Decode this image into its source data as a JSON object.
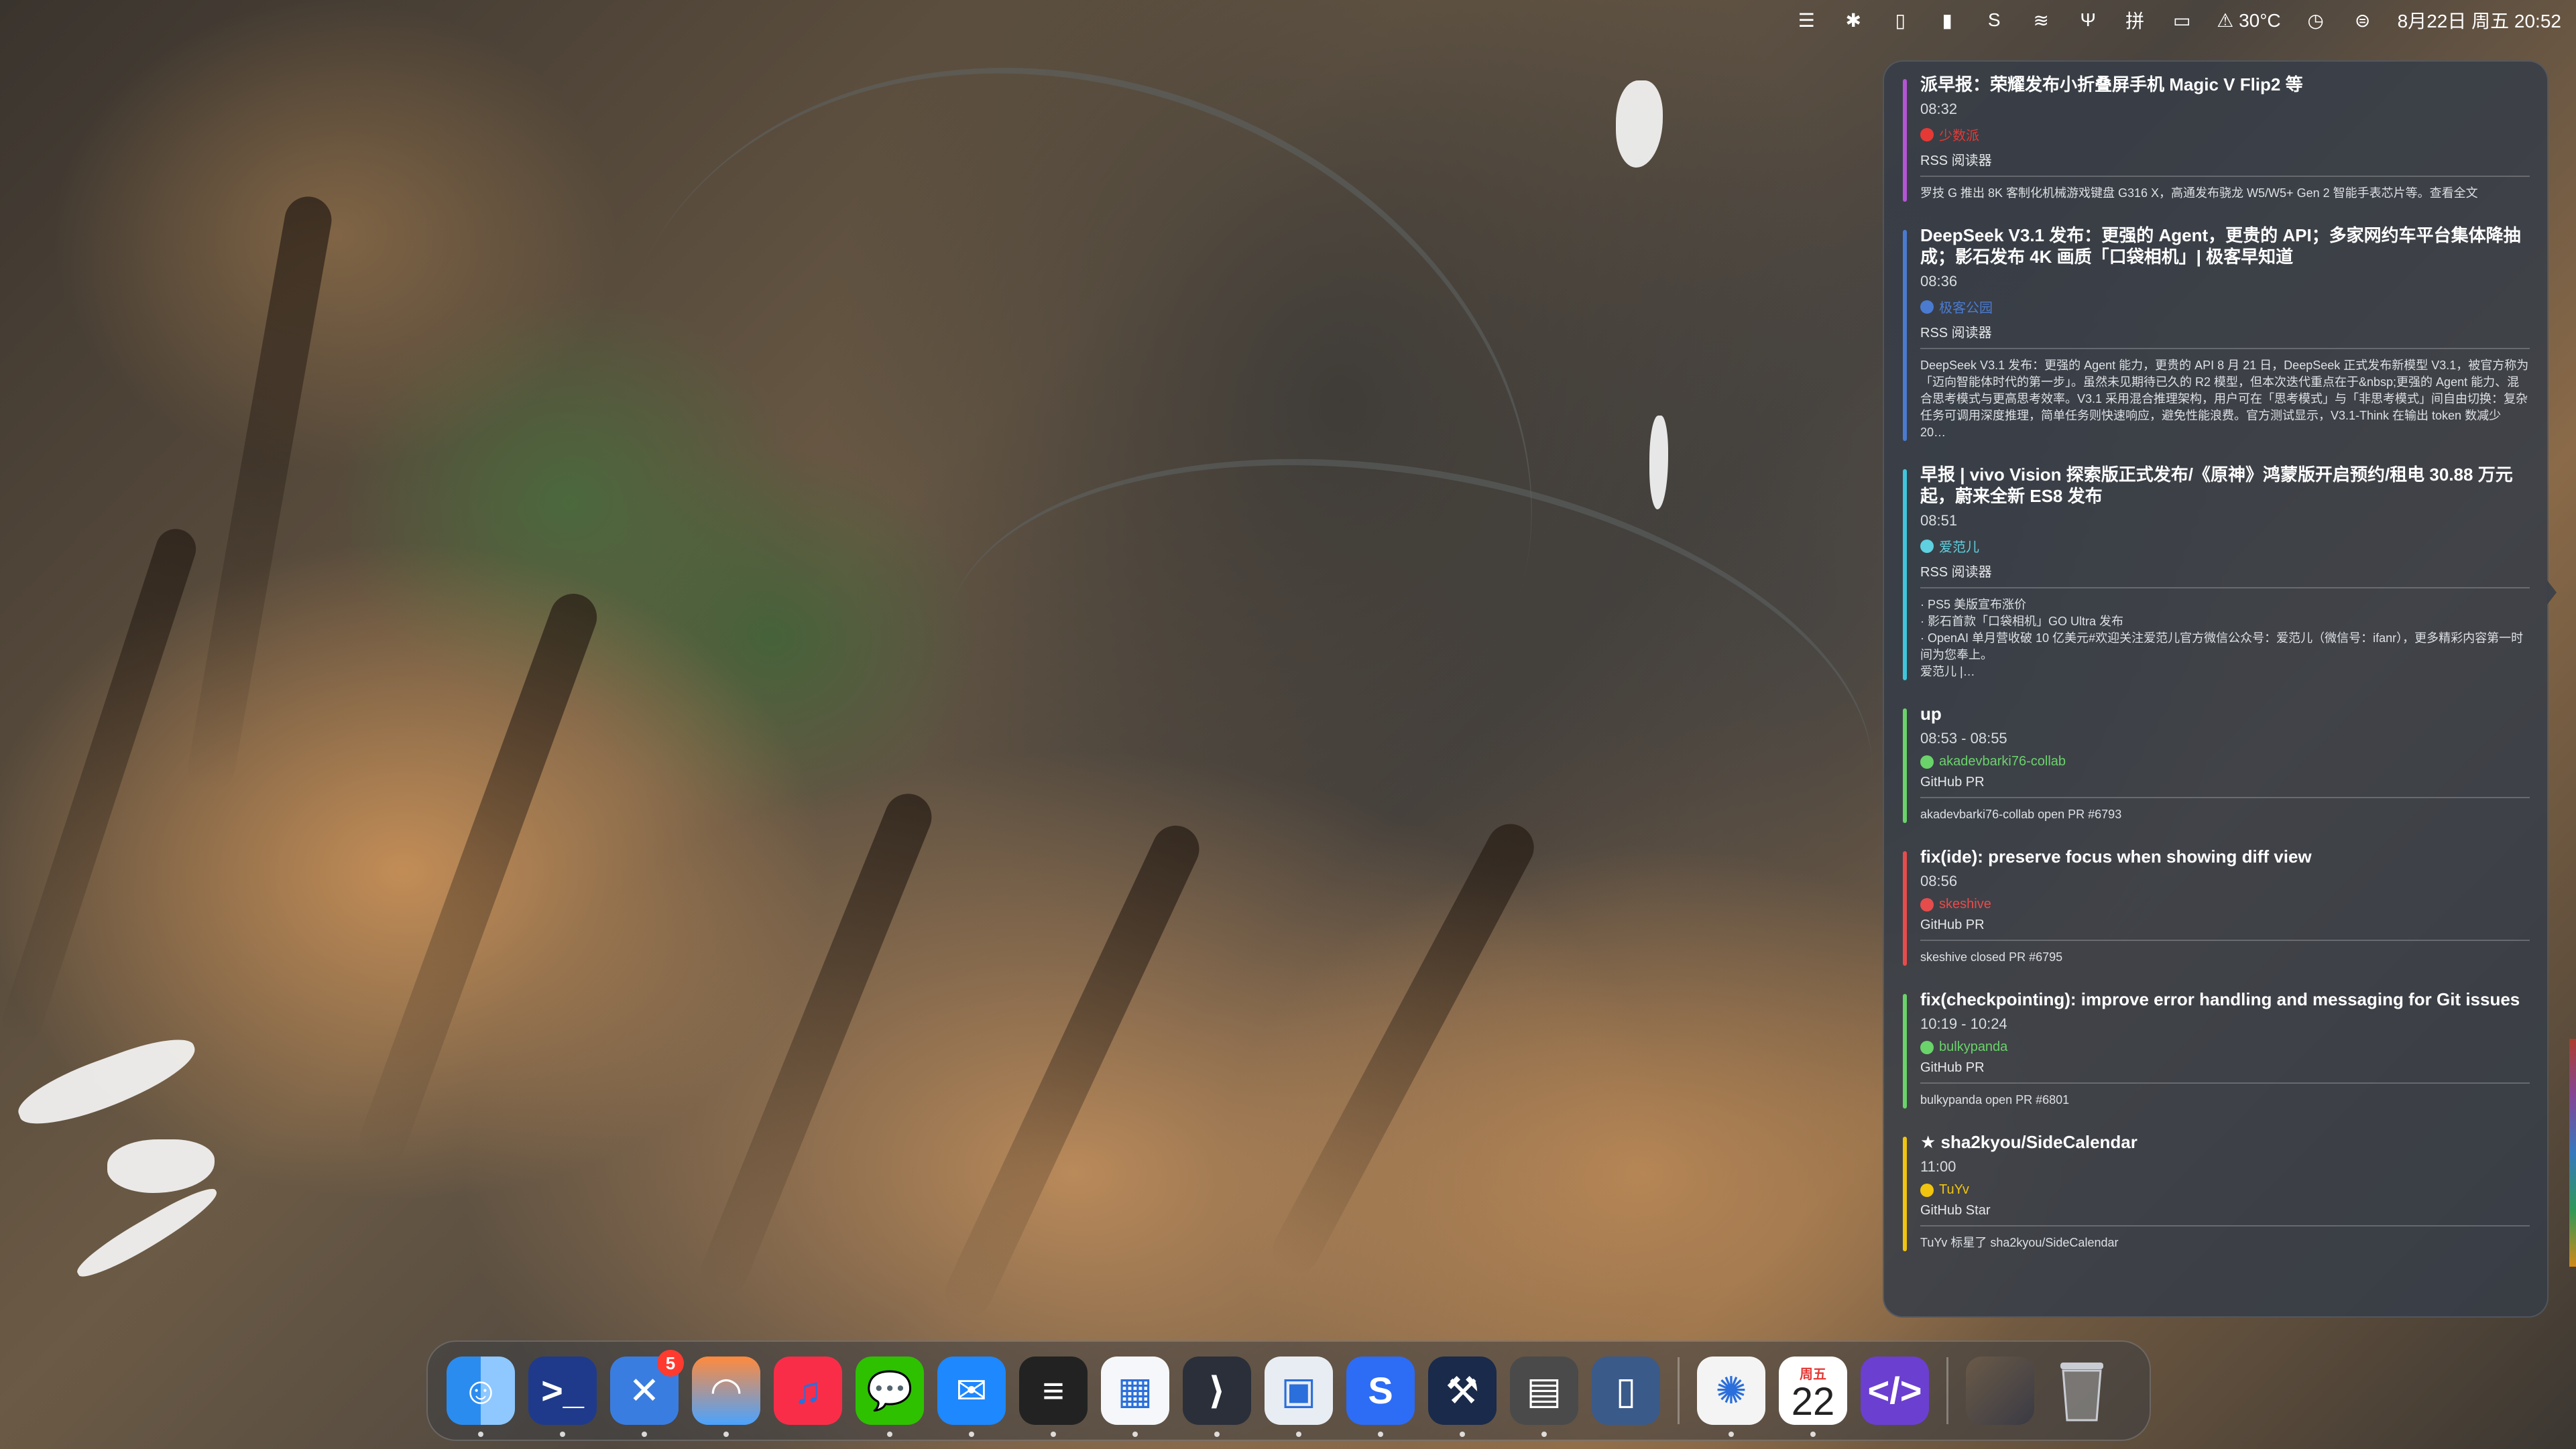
{
  "menubar": {
    "icons": [
      "stage-manager-icon",
      "bluetooth-dnd-icon",
      "sidebar-left-icon",
      "sidebar-right-icon",
      "shadowsocks-icon",
      "wifi-icon",
      "fork-icon",
      "input-method-icon",
      "battery-icon",
      "warning-icon",
      "time-machine-icon",
      "control-center-icon"
    ],
    "weather": "30°C",
    "weather_icon": "warning-triangle",
    "datetime": "8月22日 周五  20:52"
  },
  "panel": {
    "events": [
      {
        "title": "派早报：荣耀发布小折叠屏手机 Magic V Flip2 等",
        "time": "08:32",
        "author": "少数派",
        "author_color": "#e53935",
        "source": "RSS 阅读器",
        "description": "罗技 G 推出 8K 客制化机械游戏键盘 G316 X，高通发布骁龙 W5/W5+ Gen 2 智能手表芯片等。查看全文",
        "color": "#b455d6"
      },
      {
        "title": "DeepSeek V3.1 发布：更强的 Agent，更贵的 API；多家网约车平台集体降抽成；影石发布 4K 画质「口袋相机」| 极客早知道",
        "time": "08:36",
        "author": "极客公园",
        "author_color": "#4a7bd0",
        "source": "RSS 阅读器",
        "description": "DeepSeek V3.1 发布：更强的 Agent 能力，更贵的 API 8 月 21 日，DeepSeek 正式发布新模型 V3.1，被官方称为「迈向智能体时代的第一步」。虽然未见期待已久的 R2 模型，但本次迭代重点在于&nbsp;更强的 Agent 能力、混合思考模式与更高思考效率。V3.1 采用混合推理架构，用户可在「思考模式」与「非思考模式」间自由切换：复杂任务可调用深度推理，简单任务则快速响应，避免性能浪费。官方测试显示，V3.1-Think 在输出 token 数减少 20…",
        "color": "#4a7bd0"
      },
      {
        "title": "早报 | vivo Vision 探索版正式发布/《原神》鸿蒙版开启预约/租电 30.88 万元起，蔚来全新 ES8 发布",
        "time": "08:51",
        "author": "爱范儿",
        "author_color": "#5fd0e0",
        "source": "RSS 阅读器",
        "description": "· PS5 美版宣布涨价\n· 影石首款「口袋相机」GO Ultra 发布\n· OpenAI 单月营收破 10 亿美元#欢迎关注爱范儿官方微信公众号：爱范儿（微信号：ifanr），更多精彩内容第一时间为您奉上。\n爱范儿 |…",
        "color": "#3fc6dc"
      },
      {
        "title": "up",
        "time": "08:53 - 08:55",
        "author": "akadevbarki76-collab",
        "author_color": "#6ad36a",
        "source": "GitHub PR",
        "description": "akadevbarki76-collab open PR #6793",
        "color": "#6ad36a"
      },
      {
        "title": "fix(ide): preserve focus when showing diff view",
        "time": "08:56",
        "author": "skeshive",
        "author_color": "#e74c4c",
        "source": "GitHub PR",
        "description": "skeshive closed PR #6795",
        "color": "#e74c4c"
      },
      {
        "title": "fix(checkpointing): improve error handling and messaging for Git issues",
        "time": "10:19 - 10:24",
        "author": "bulkypanda",
        "author_color": "#6ad36a",
        "source": "GitHub PR",
        "description": "bulkypanda open PR #6801",
        "color": "#6ad36a"
      },
      {
        "title": "★ sha2kyou/SideCalendar",
        "time": "11:00",
        "author": "TuYv",
        "author_color": "#f1c40f",
        "source": "GitHub Star",
        "description": "TuYv 标星了 sha2kyou/SideCalendar",
        "color": "#f1c40f"
      }
    ]
  },
  "dock": {
    "apps": [
      {
        "name": "finder-icon",
        "glyph": "☺",
        "bg": "linear-gradient(90deg,#2b8cf0 50%,#8ec8ff 50%)",
        "running": true
      },
      {
        "name": "terminal-icon",
        "glyph": ">_",
        "bg": "#1f3a8a",
        "running": true
      },
      {
        "name": "xcode-tools-icon",
        "glyph": "✕",
        "bg": "#3a7de0",
        "running": true,
        "badge": "5"
      },
      {
        "name": "arc-browser-icon",
        "glyph": "◠",
        "bg": "linear-gradient(180deg,#ff8a3d,#4aa3ff)",
        "running": true
      },
      {
        "name": "music-icon",
        "glyph": "♫",
        "bg": "#fa2d48",
        "running": false
      },
      {
        "name": "wechat-icon",
        "glyph": "💬",
        "bg": "#2dc100",
        "running": true
      },
      {
        "name": "mail-icon",
        "glyph": "✉",
        "bg": "#1e88ff",
        "running": true
      },
      {
        "name": "notes-icon",
        "glyph": "≡",
        "bg": "#222",
        "running": true
      },
      {
        "name": "windows-app-icon",
        "glyph": "▦",
        "bg": "#f5f7fa",
        "running": true
      },
      {
        "name": "vscode-icon",
        "glyph": "⟩",
        "bg": "#2a2f3a",
        "running": true
      },
      {
        "name": "screenshot-tool-icon",
        "glyph": "▣",
        "bg": "#e8edf3",
        "running": true
      },
      {
        "name": "shadowrocket-icon",
        "glyph": "S",
        "bg": "#2d6cf5",
        "running": true
      },
      {
        "name": "xcode-beta-icon",
        "glyph": "⚒",
        "bg": "#1a2a4a",
        "running": true
      },
      {
        "name": "files-icon",
        "glyph": "▤",
        "bg": "#4a4a4a",
        "running": true
      },
      {
        "name": "simulator-icon",
        "glyph": "▯",
        "bg": "#3a5a8a",
        "running": false
      }
    ],
    "recent_apps": [
      {
        "name": "chatgpt-icon",
        "glyph": "✺",
        "bg": "#f4f4f4",
        "running": true
      },
      {
        "name": "calendar-icon",
        "weekday": "周五",
        "day": "22",
        "running": true
      },
      {
        "name": "code-editor-icon",
        "glyph": "</>",
        "bg": "#6b3fd0",
        "running": false
      }
    ],
    "stack": {
      "name": "downloads-stack-icon"
    },
    "trash": {
      "name": "trash-icon"
    }
  }
}
